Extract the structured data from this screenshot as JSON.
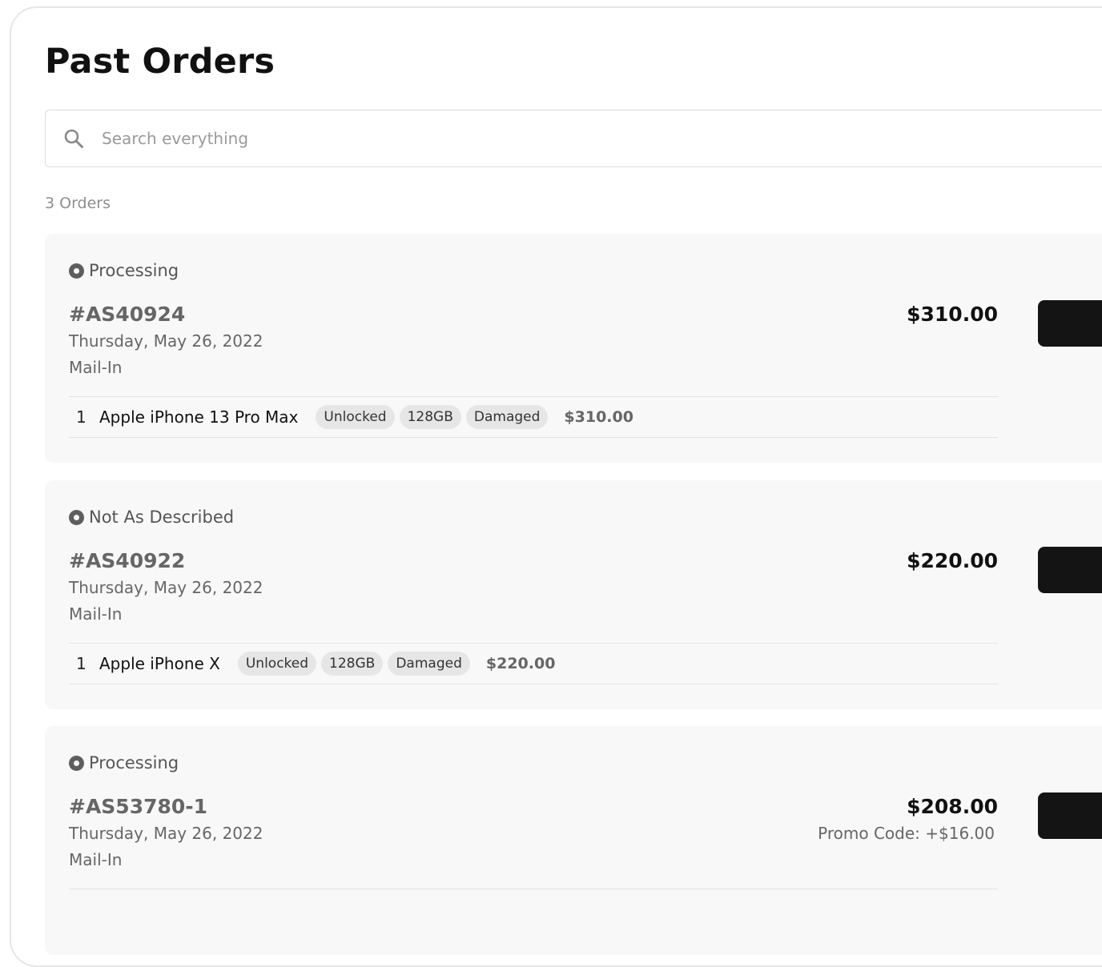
{
  "page": {
    "title": "Past Orders"
  },
  "search": {
    "placeholder": "Search everything",
    "value": ""
  },
  "summary": {
    "count_label": "3 Orders"
  },
  "orders": [
    {
      "status": "Processing",
      "id": "#AS40924",
      "date": "Thursday, May 26, 2022",
      "method": "Mail-In",
      "total": "$310.00",
      "items": [
        {
          "qty": "1",
          "name": "Apple iPhone 13 Pro Max",
          "tags": [
            "Unlocked",
            "128GB",
            "Damaged"
          ],
          "price": "$310.00"
        }
      ]
    },
    {
      "status": "Not As Described",
      "id": "#AS40922",
      "date": "Thursday, May 26, 2022",
      "method": "Mail-In",
      "total": "$220.00",
      "items": [
        {
          "qty": "1",
          "name": "Apple iPhone X",
          "tags": [
            "Unlocked",
            "128GB",
            "Damaged"
          ],
          "price": "$220.00"
        }
      ]
    },
    {
      "status": "Processing",
      "id": "#AS53780-1",
      "date": "Thursday, May 26, 2022",
      "method": "Mail-In",
      "total": "$208.00",
      "promo": "Promo Code: +$16.00",
      "items": []
    }
  ],
  "colors": {
    "card_background": "#f8f8f8",
    "button_background": "#141414",
    "status_icon": "#5e5e5e",
    "tag_background": "#e6e6e6"
  },
  "icons": {
    "search": "search-icon",
    "status": "status-dot-icon"
  }
}
